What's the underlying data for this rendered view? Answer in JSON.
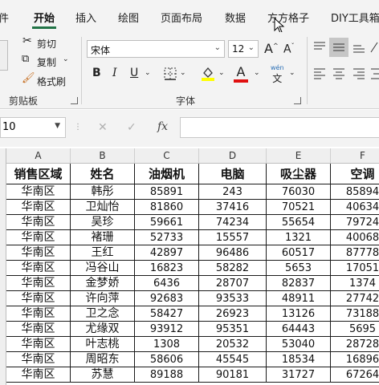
{
  "tabs": [
    "件",
    "开始",
    "插入",
    "绘图",
    "页面布局",
    "数据",
    "方方格子",
    "DIY工具箱"
  ],
  "clipboard": {
    "cut": "剪切",
    "copy": "复制",
    "format_painter": "格式刷",
    "label": "剪贴板"
  },
  "font": {
    "name": "宋体",
    "size": "12",
    "label": "字体",
    "grow": "A",
    "shrink": "A",
    "bold": "B",
    "italic": "I",
    "underline": "U",
    "wen": "wén",
    "wen_char": "文"
  },
  "namebox": {
    "value": "10"
  },
  "formula_buttons": {
    "cancel": "✕",
    "enter": "✓",
    "fx": "fx"
  },
  "columns": [
    "A",
    "B",
    "C",
    "D",
    "E",
    "F"
  ],
  "table": {
    "headers": [
      "销售区域",
      "姓名",
      "油烟机",
      "电脑",
      "吸尘器",
      "空调"
    ],
    "rows": [
      [
        "华南区",
        "韩彤",
        "85891",
        "243",
        "76030",
        "85894"
      ],
      [
        "华南区",
        "卫灿怡",
        "81860",
        "37416",
        "70521",
        "40634"
      ],
      [
        "华南区",
        "吴珍",
        "59661",
        "74234",
        "55654",
        "79724"
      ],
      [
        "华南区",
        "褚珊",
        "52733",
        "15557",
        "1321",
        "40068"
      ],
      [
        "华南区",
        "王红",
        "42897",
        "96486",
        "60517",
        "87778"
      ],
      [
        "华南区",
        "冯谷山",
        "16823",
        "58282",
        "5653",
        "17051"
      ],
      [
        "华南区",
        "金梦娇",
        "6436",
        "28707",
        "82837",
        "1374"
      ],
      [
        "华南区",
        "许向萍",
        "92683",
        "93533",
        "48911",
        "27742"
      ],
      [
        "华南区",
        "卫之念",
        "58427",
        "26923",
        "13126",
        "73188"
      ],
      [
        "华南区",
        "尤缘双",
        "93912",
        "95351",
        "64443",
        "5695"
      ],
      [
        "华南区",
        "叶志桃",
        "1308",
        "20532",
        "53040",
        "28728"
      ],
      [
        "华南区",
        "周昭东",
        "58606",
        "45545",
        "18534",
        "16896"
      ],
      [
        "华南区",
        "苏慧",
        "89188",
        "90181",
        "31727",
        "67264"
      ]
    ]
  }
}
